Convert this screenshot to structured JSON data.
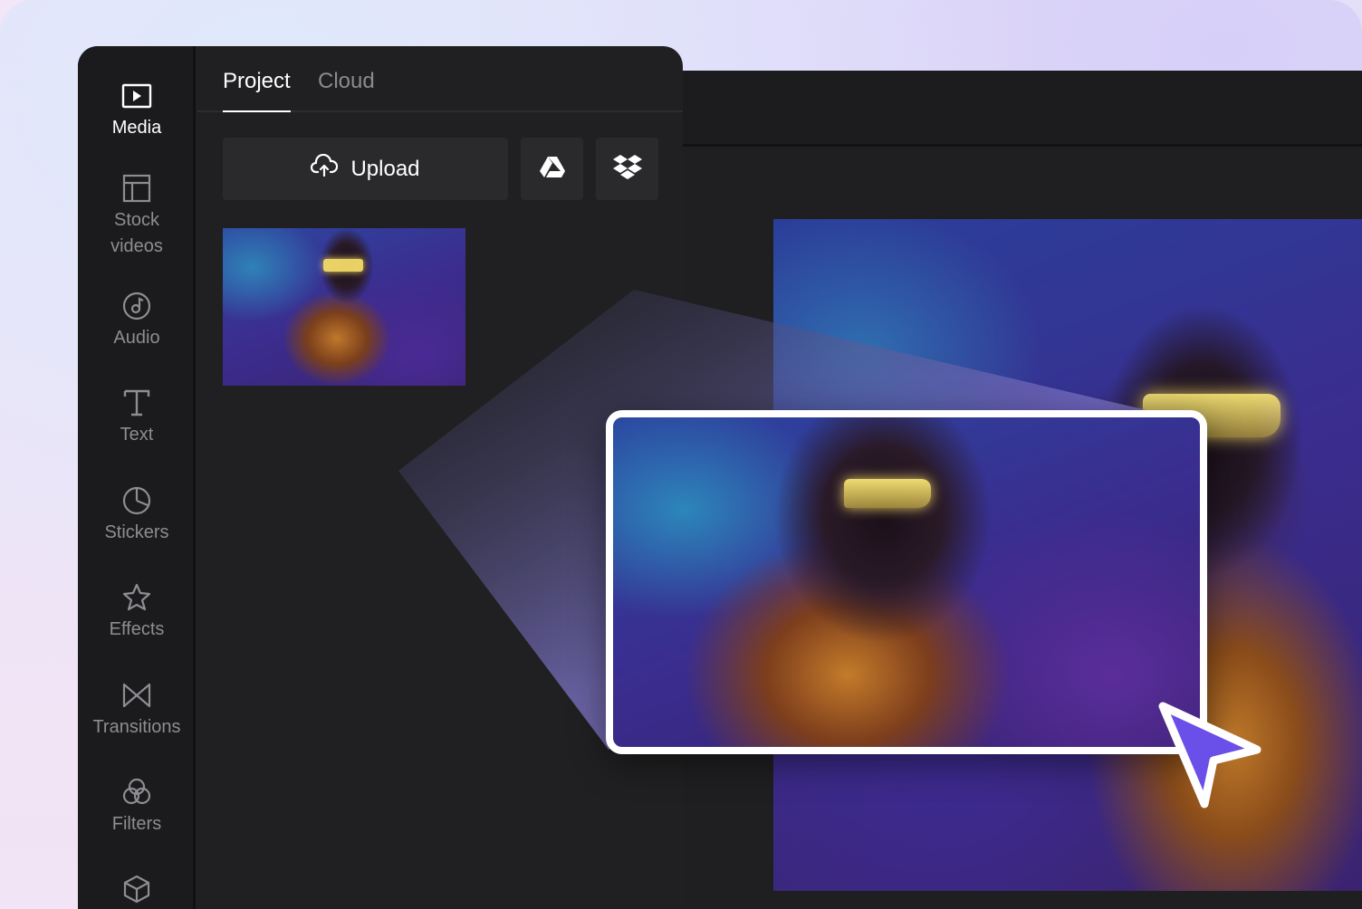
{
  "sidebar": {
    "items": [
      {
        "label": "Media",
        "icon": "media-icon"
      },
      {
        "label": "Stock\nvideos",
        "icon": "stock-videos-icon"
      },
      {
        "label": "Audio",
        "icon": "audio-icon"
      },
      {
        "label": "Text",
        "icon": "text-icon"
      },
      {
        "label": "Stickers",
        "icon": "stickers-icon"
      },
      {
        "label": "Effects",
        "icon": "effects-icon"
      },
      {
        "label": "Transitions",
        "icon": "transitions-icon"
      },
      {
        "label": "Filters",
        "icon": "filters-icon"
      },
      {
        "label": "",
        "icon": "3d-box-icon"
      }
    ],
    "active_index": 0
  },
  "tabs": [
    {
      "label": "Project",
      "active": true
    },
    {
      "label": "Cloud",
      "active": false
    }
  ],
  "toolbar": {
    "upload_label": "Upload",
    "upload_icon": "cloud-upload-icon",
    "google_drive_icon": "google-drive-icon",
    "dropbox_icon": "dropbox-icon"
  },
  "colors": {
    "panel": "#202022",
    "sidebar": "#1b1b1d",
    "button": "#2a2a2d",
    "cursor_accent": "#6a4fe8",
    "active_text": "#ffffff",
    "inactive_text": "#8a8a90"
  }
}
